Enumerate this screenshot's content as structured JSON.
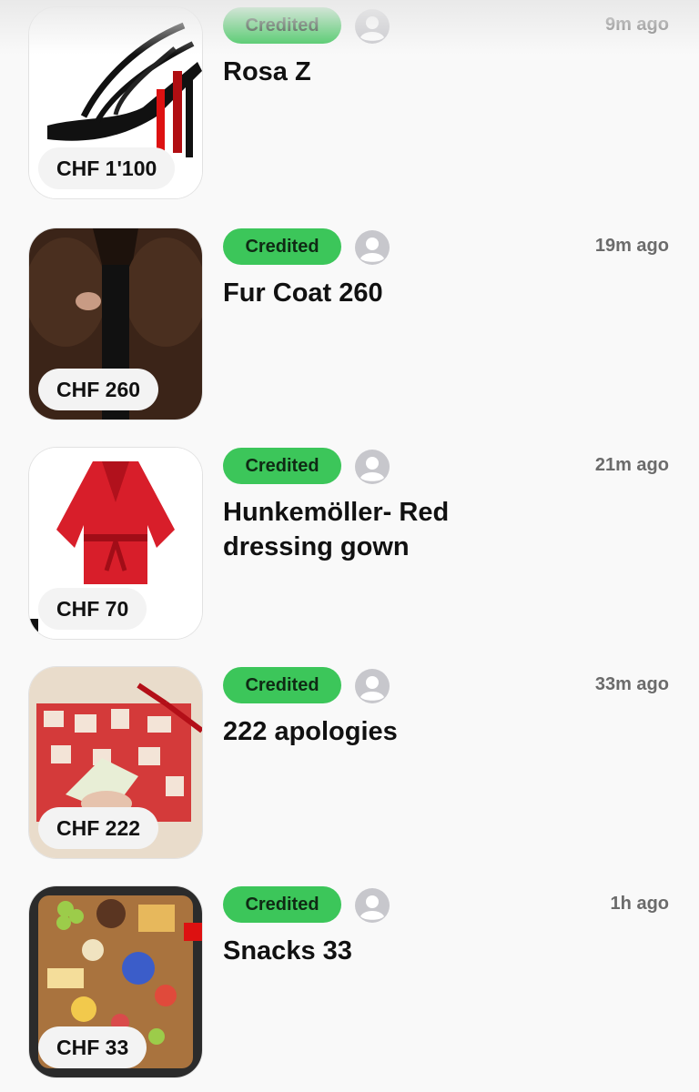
{
  "feed": [
    {
      "status": "Credited",
      "title": "Rosa Z",
      "time": "9m ago",
      "price": "CHF 1'100",
      "image": "black-heels"
    },
    {
      "status": "Credited",
      "title": "Fur Coat 260",
      "time": "19m ago",
      "price": "CHF 260",
      "image": "fur-coat"
    },
    {
      "status": "Credited",
      "title": "Hunkemöller- Red dressing gown",
      "time": "21m ago",
      "price": "CHF 70",
      "image": "red-dressing-gown"
    },
    {
      "status": "Credited",
      "title": "222 apologies",
      "time": "33m ago",
      "price": "CHF 222",
      "image": "gift-box"
    },
    {
      "status": "Credited",
      "title": "Snacks 33",
      "time": "1h ago",
      "price": "CHF 33",
      "image": "snack-board"
    }
  ],
  "colors": {
    "credited_badge": "#3cc65a",
    "background": "#f9f9f9",
    "avatar": "#c7c7cc"
  },
  "icons": {
    "avatar": "person-circle-icon"
  }
}
